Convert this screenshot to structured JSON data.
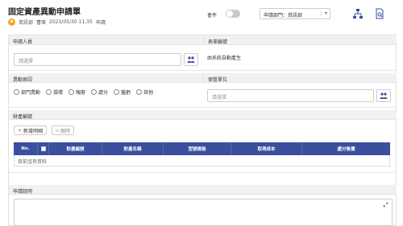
{
  "header": {
    "title": "固定資產異動申請單",
    "user_dept": "資訊部",
    "user_name": "曹瑤",
    "datetime": "2023/05/30 11:35",
    "status": "申請",
    "toggle_label": "會件",
    "dept_select_value": "申請部門：資訊部"
  },
  "form": {
    "applicant": {
      "label": "申請人員",
      "placeholder": "請選擇"
    },
    "form_no": {
      "label": "表單編號",
      "value": "由系統自動產生"
    },
    "reason": {
      "label": "異動原因",
      "options": [
        "部門異動",
        "損壞",
        "報廢",
        "處分",
        "盤虧",
        "其他"
      ]
    },
    "custodian": {
      "label": "保管單位",
      "placeholder": "請選擇"
    },
    "details": {
      "label": "財產編號",
      "add_button": "新增明細",
      "delete_button": "刪除",
      "columns": [
        "No.",
        "",
        "財產編號",
        "財產名稱",
        "型號規格",
        "取得成本",
        "處分售價"
      ],
      "empty_text": "目前沒有資料"
    },
    "description": {
      "label": "申請說明"
    }
  }
}
